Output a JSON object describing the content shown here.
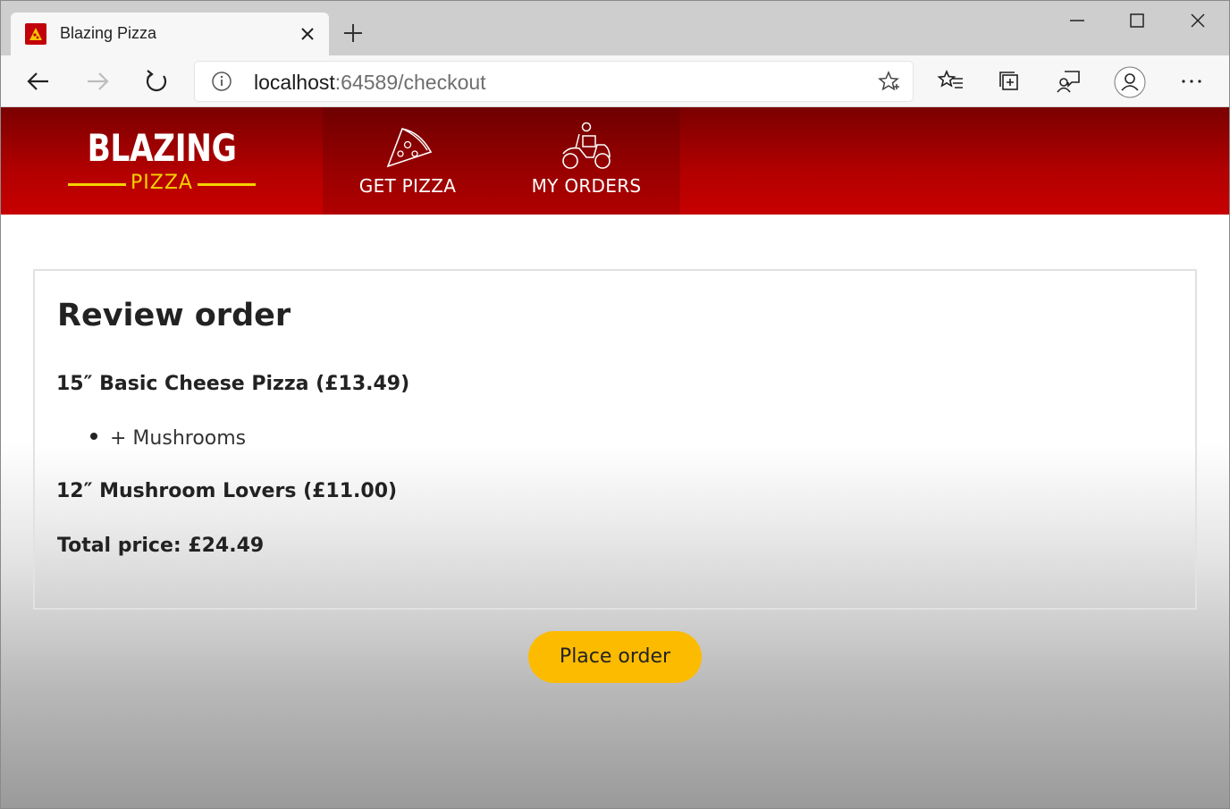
{
  "browser": {
    "tab_title": "Blazing Pizza",
    "url_host": "localhost",
    "url_path": ":64589/checkout",
    "icons": {
      "favicon": "pizza-favicon-icon",
      "tab_close": "close-icon",
      "new_tab": "plus-icon",
      "back": "back-arrow-icon",
      "forward": "forward-arrow-icon",
      "refresh": "refresh-icon",
      "site_info": "info-icon",
      "favorite": "star-icon",
      "favorites_list": "favorites-icon",
      "collections": "collections-icon",
      "feedback": "feedback-icon",
      "profile": "profile-icon",
      "more": "more-icon",
      "minimize": "minimize-icon",
      "maximize": "maximize-icon",
      "close_window": "close-window-icon"
    }
  },
  "header": {
    "logo_top": "BLAZING",
    "logo_bottom": "PIZZA",
    "nav": [
      {
        "label": "GET PIZZA",
        "icon": "pizza-slice-icon"
      },
      {
        "label": "MY ORDERS",
        "icon": "delivery-bike-icon"
      }
    ],
    "colors": {
      "header_red": "#c70000",
      "logo_yellow": "#f5d100"
    }
  },
  "checkout": {
    "title": "Review order",
    "items": [
      {
        "name": "15″ Basic Cheese Pizza (£13.49)",
        "toppings": [
          "+ Mushrooms"
        ]
      },
      {
        "name": "12″ Mushroom Lovers (£11.00)",
        "toppings": []
      }
    ],
    "total": "Total price: £24.49",
    "place_order_label": "Place order",
    "colors": {
      "button": "#fdbb00"
    }
  }
}
